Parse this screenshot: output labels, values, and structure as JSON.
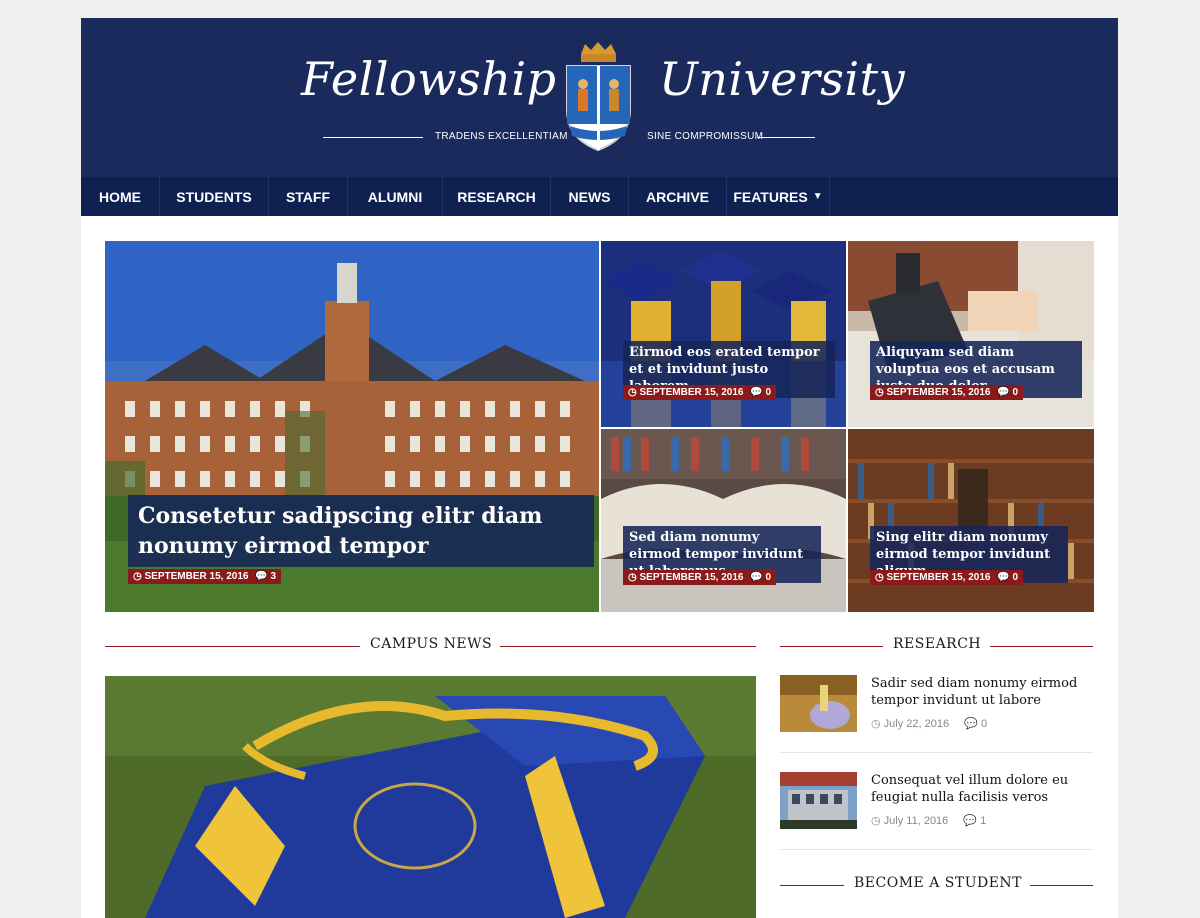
{
  "header": {
    "brand_left": "Fellowship",
    "brand_right": "University",
    "motto_left": "TRADENS EXCELLENTIAM",
    "motto_right": "SINE COMPROMISSUM"
  },
  "nav": {
    "items": [
      "HOME",
      "STUDENTS",
      "STAFF",
      "ALUMNI",
      "RESEARCH",
      "NEWS",
      "ARCHIVE",
      "FEATURES"
    ]
  },
  "featured": {
    "main": {
      "title": "Consetetur sadipscing elitr diam nonumy eirmod tempor",
      "date": "SEPTEMBER 15, 2016",
      "comments": "3"
    },
    "tiles": [
      {
        "title": "Eirmod eos erated tempor et et invidunt justo laborem",
        "date": "SEPTEMBER 15, 2016",
        "comments": "0"
      },
      {
        "title": "Aliquyam sed diam voluptua eos et accusam justo duo dolor",
        "date": "SEPTEMBER 15, 2016",
        "comments": "0"
      },
      {
        "title": "Sed diam nonumy eirmod tempor invidunt ut laboremus",
        "date": "SEPTEMBER 15, 2016",
        "comments": "0"
      },
      {
        "title": "Sing elitr diam nonumy eirmod tempor invidunt aliqum",
        "date": "SEPTEMBER 15, 2016",
        "comments": "0"
      }
    ]
  },
  "sections": {
    "campus_news": "CAMPUS NEWS",
    "research": "RESEARCH",
    "become_student": "BECOME A STUDENT"
  },
  "research": {
    "items": [
      {
        "title": "Sadir sed diam nonumy eirmod tempor invidunt ut labore",
        "date": "July 22, 2016",
        "comments": "0"
      },
      {
        "title": "Consequat vel illum dolore eu feugiat nulla facilisis veros",
        "date": "July 11, 2016",
        "comments": "1"
      }
    ]
  },
  "icons": {
    "clock": "clock-icon",
    "comment": "comment-icon",
    "chevron": "chevron-down-icon"
  },
  "colors": {
    "header_bg": "#1b2a5c",
    "nav_bg": "#0f2150",
    "accent": "#8b1a1a"
  }
}
